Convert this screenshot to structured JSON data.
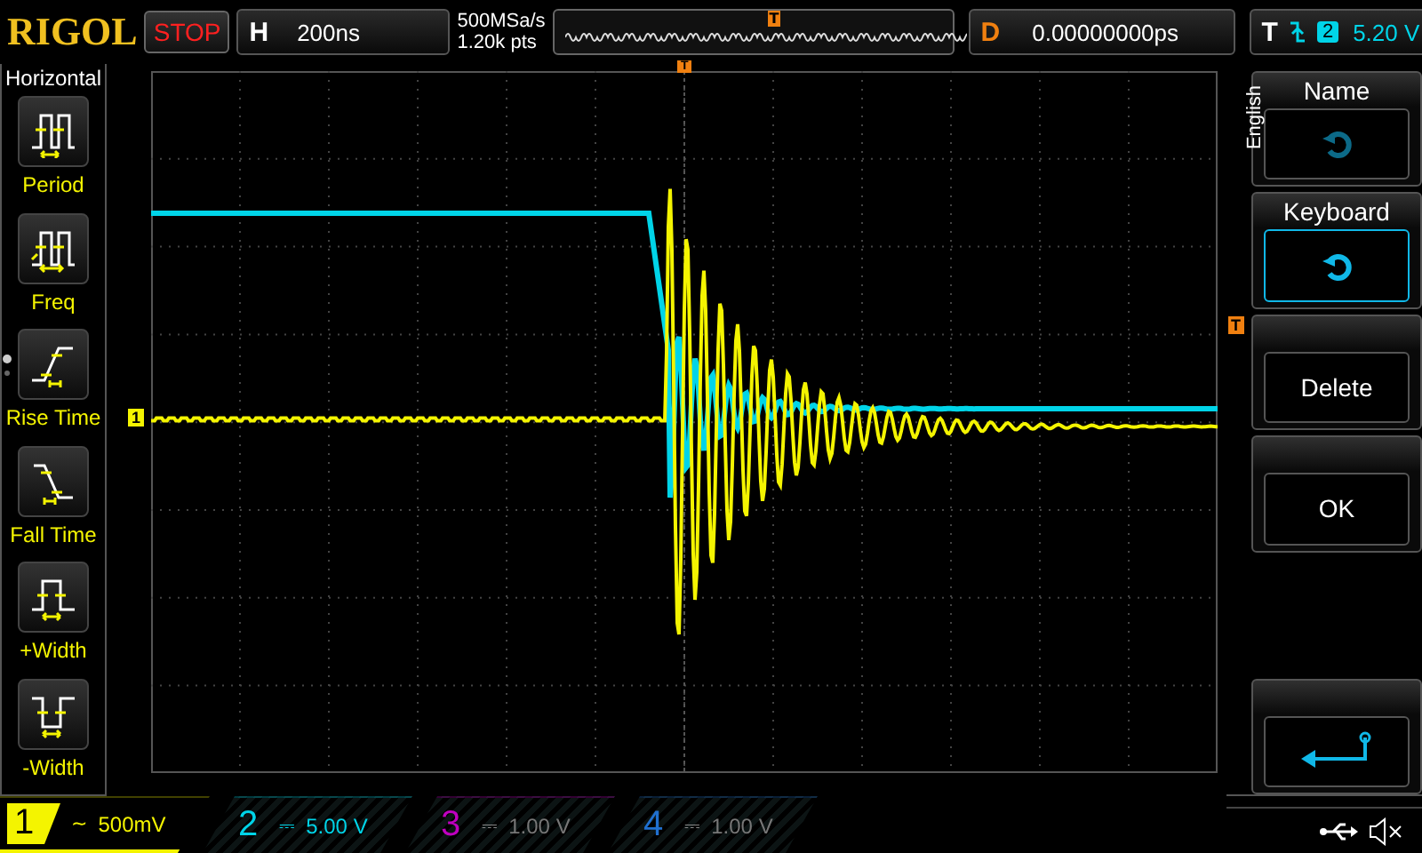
{
  "top_bar": {
    "logo": "RIGOL",
    "run_status": "STOP",
    "horizontal": {
      "label": "H",
      "timebase": "200ns",
      "sample_rate": "500MSa/s",
      "memory_depth": "1.20k pts",
      "trigger_marker": "T"
    },
    "delay": {
      "label": "D",
      "value": "0.00000000ps"
    },
    "trigger": {
      "label": "T",
      "source": "2",
      "level": "5.20 V"
    }
  },
  "left_menu": {
    "title": "Horizontal",
    "items": [
      {
        "label": "Period",
        "kind": "period"
      },
      {
        "label": "Freq",
        "kind": "freq"
      },
      {
        "label": "Rise Time",
        "kind": "rise"
      },
      {
        "label": "Fall Time",
        "kind": "fall"
      },
      {
        "label": "+Width",
        "kind": "pwidth"
      },
      {
        "label": "-Width",
        "kind": "nwidth"
      }
    ]
  },
  "display": {
    "channel_marker": "1",
    "trigger_level_marker": "T",
    "trigger_position_marker": "T"
  },
  "right_menu": {
    "language": "English",
    "items": [
      {
        "label": "Name",
        "kind": "knob",
        "selected": false
      },
      {
        "label": "Keyboard",
        "kind": "knob",
        "selected": true
      },
      {
        "label": "Delete",
        "kind": "button",
        "selected": false
      },
      {
        "label": "OK",
        "kind": "button",
        "selected": false
      },
      {
        "kind": "back",
        "selected": false
      }
    ]
  },
  "channels": [
    {
      "number": "1",
      "coupling": "~",
      "scale": "500mV",
      "on": true,
      "selected": true,
      "color": "#f4f400"
    },
    {
      "number": "2",
      "coupling": "⎓",
      "scale": "5.00 V",
      "on": true,
      "selected": false,
      "color": "#00d4e8"
    },
    {
      "number": "3",
      "coupling": "⎓",
      "scale": "1.00 V",
      "on": false,
      "selected": false,
      "color": "#c000c0"
    },
    {
      "number": "4",
      "coupling": "⎓",
      "scale": "1.00 V",
      "on": false,
      "selected": false,
      "color": "#2070d0"
    }
  ]
}
